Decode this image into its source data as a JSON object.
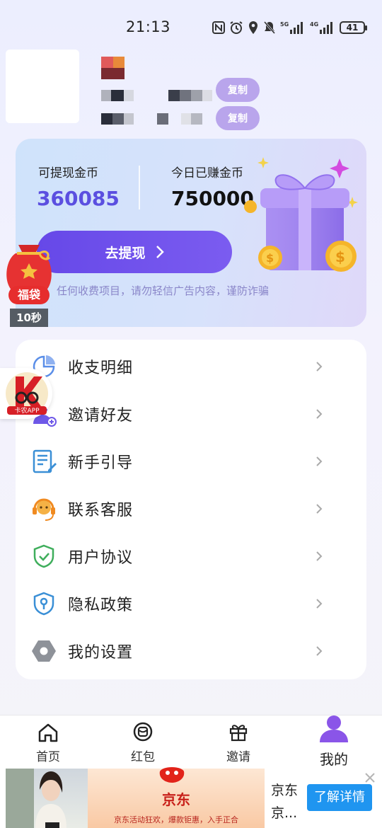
{
  "status_bar": {
    "time": "21:13",
    "battery": "41",
    "net1": "5G",
    "net2": "4G"
  },
  "profile": {
    "copy_label_1": "复制",
    "copy_label_2": "复制"
  },
  "wallet": {
    "withdrawable_label": "可提现金币",
    "withdrawable_value": "360085",
    "today_label": "今日已赚金币",
    "today_value": "750000",
    "withdraw_button": "去提现",
    "notice": "任何收费项目，请勿轻信广告内容，谨防诈骗"
  },
  "lucky_bag": {
    "label": "福袋",
    "timer": "10秒",
    "app_badge": "卡农APP"
  },
  "menu": {
    "items": [
      {
        "label": "收支明细",
        "icon": "pie-chart-icon"
      },
      {
        "label": "邀请好友",
        "icon": "add-user-icon"
      },
      {
        "label": "新手引导",
        "icon": "guide-edit-icon"
      },
      {
        "label": "联系客服",
        "icon": "headset-icon"
      },
      {
        "label": "用户协议",
        "icon": "shield-check-icon"
      },
      {
        "label": "隐私政策",
        "icon": "shield-lock-icon"
      },
      {
        "label": "我的设置",
        "icon": "settings-hex-icon"
      }
    ]
  },
  "tabbar": {
    "tabs": [
      {
        "label": "首页",
        "icon": "home-icon"
      },
      {
        "label": "红包",
        "icon": "red-envelope-icon"
      },
      {
        "label": "邀请",
        "icon": "gift-icon"
      },
      {
        "label": "我的",
        "icon": "person-icon",
        "active": true
      }
    ]
  },
  "ad": {
    "brand": "京东",
    "banner_sub": "京东活动狂欢，爆款钜惠，入手正合",
    "title": "京东",
    "subtitle": "京...",
    "cta": "了解详情"
  },
  "colors": {
    "accent": "#6648e8",
    "value_purple": "#5b4fe0",
    "copy_bg": "#b9a5ec",
    "tab_active": "#8a55e8",
    "ad_button": "#1f95f0"
  }
}
